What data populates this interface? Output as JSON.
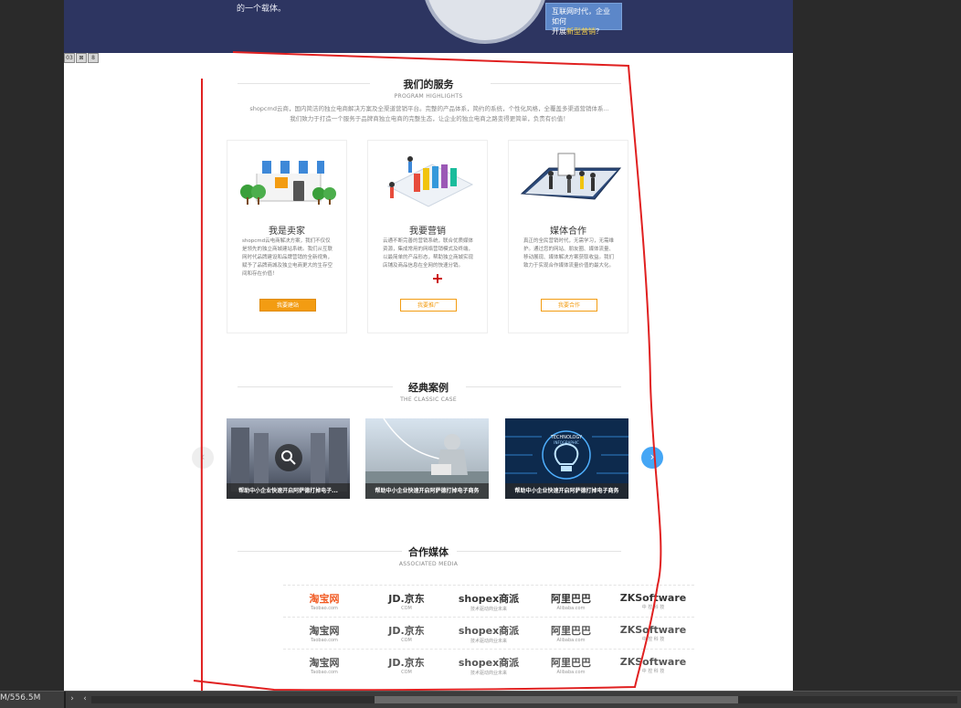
{
  "banner": {
    "text": "的一个载体。",
    "bubble_line1": "互联网时代，企业如何",
    "bubble_line2_prefix": "开展",
    "bubble_line2_highlight": "新型营销",
    "bubble_line2_suffix": "？"
  },
  "toolbar_icons": [
    "03",
    "⊠",
    "8"
  ],
  "services": {
    "title": "我们的服务",
    "subtitle": "PROGRAM HIGHLIGHTS",
    "intro_line1": "shopcmd云商，国内简洁的独立电商解决方案及全渠道营销平台。完整的产品体系，简约的系统，个性化风格，全覆盖多渠道营销体系...",
    "intro_line2": "我们致力于打造一个服务于品牌商独立电商的完整生态，让企业的独立电商之路变得更简单，负责有价值！",
    "cards": [
      {
        "title": "我是卖家",
        "desc": "shopcmd云电商解决方案，我们不仅仅是领先的独立商城建站系统。我们从互联网时代品牌建设和品牌营销的全新视角，赋予了品牌商城及独立电商更大的生存空间和存在价值！",
        "button": "我要建站",
        "icon": "shop-icon"
      },
      {
        "title": "我要营销",
        "desc": "云通不断完善的营销系统，联合优质媒体资源，集成常用的网络营销模式及终端，以最简单的产品形态，帮助独立商城实现店铺及商品信息在全网的快速分销。",
        "button": "我要推广",
        "icon": "chart-icon"
      },
      {
        "title": "媒体合作",
        "desc": "真正的全民营销时代，无需学习，无需维护。通过您的网站、朋友圈、媒体流量、移动展现、媒体解决方案获取收益。我们致力于实现合作媒体流量价值的最大化。",
        "button": "我要合作",
        "icon": "meeting-icon"
      }
    ]
  },
  "cases": {
    "title": "经典案例",
    "subtitle": "THE CLASSIC CASE",
    "items": [
      {
        "caption": "帮助中小企业快速开启阿萨德打掉电子..."
      },
      {
        "caption": "帮助中小企业快速开启阿萨德打掉电子商务"
      },
      {
        "caption": "帮助中小企业快速开启阿萨德打掉电子商务",
        "image_text_1": "TECHNOLOGY",
        "image_text_2": "INFOGRAPHIC"
      }
    ],
    "prev_symbol": "‹",
    "next_symbol": "›"
  },
  "media": {
    "title": "合作媒体",
    "subtitle": "ASSOCIATED MEDIA",
    "rows": [
      [
        {
          "l1": "淘宝网",
          "l2": "Taobao.com",
          "color": "#f15a22"
        },
        {
          "l1": "JD.京东",
          "l2": "COM",
          "color": "#333333"
        },
        {
          "l1": "shopex商派",
          "l2": "技术驱动商业未来",
          "color": "#333333"
        },
        {
          "l1": "阿里巴巴",
          "l2": "Alibaba.com",
          "color": "#333333"
        },
        {
          "l1": "ZKSoftware",
          "l2": "中 控 科 技",
          "color": "#333333"
        }
      ],
      [
        {
          "l1": "淘宝网",
          "l2": "Taobao.com",
          "color": "#555555"
        },
        {
          "l1": "JD.京东",
          "l2": "COM",
          "color": "#555555"
        },
        {
          "l1": "shopex商派",
          "l2": "技术驱动商业未来",
          "color": "#555555"
        },
        {
          "l1": "阿里巴巴",
          "l2": "Alibaba.com",
          "color": "#555555"
        },
        {
          "l1": "ZKSoftware",
          "l2": "中 控 科 技",
          "color": "#555555"
        }
      ],
      [
        {
          "l1": "淘宝网",
          "l2": "Taobao.com",
          "color": "#555555"
        },
        {
          "l1": "JD.京东",
          "l2": "COM",
          "color": "#555555"
        },
        {
          "l1": "shopex商派",
          "l2": "技术驱动商业未来",
          "color": "#555555"
        },
        {
          "l1": "阿里巴巴",
          "l2": "Alibaba.com",
          "color": "#555555"
        },
        {
          "l1": "ZKSoftware",
          "l2": "中 控 科 技",
          "color": "#555555"
        }
      ]
    ]
  },
  "statusbar": {
    "text": "M/556.5M",
    "nav_right": "›",
    "nav_left": "‹"
  },
  "colors": {
    "accent": "#f39c12",
    "banner_bg": "#2d3561",
    "annotation": "#e02020",
    "arrow_active": "#45a6f5"
  }
}
